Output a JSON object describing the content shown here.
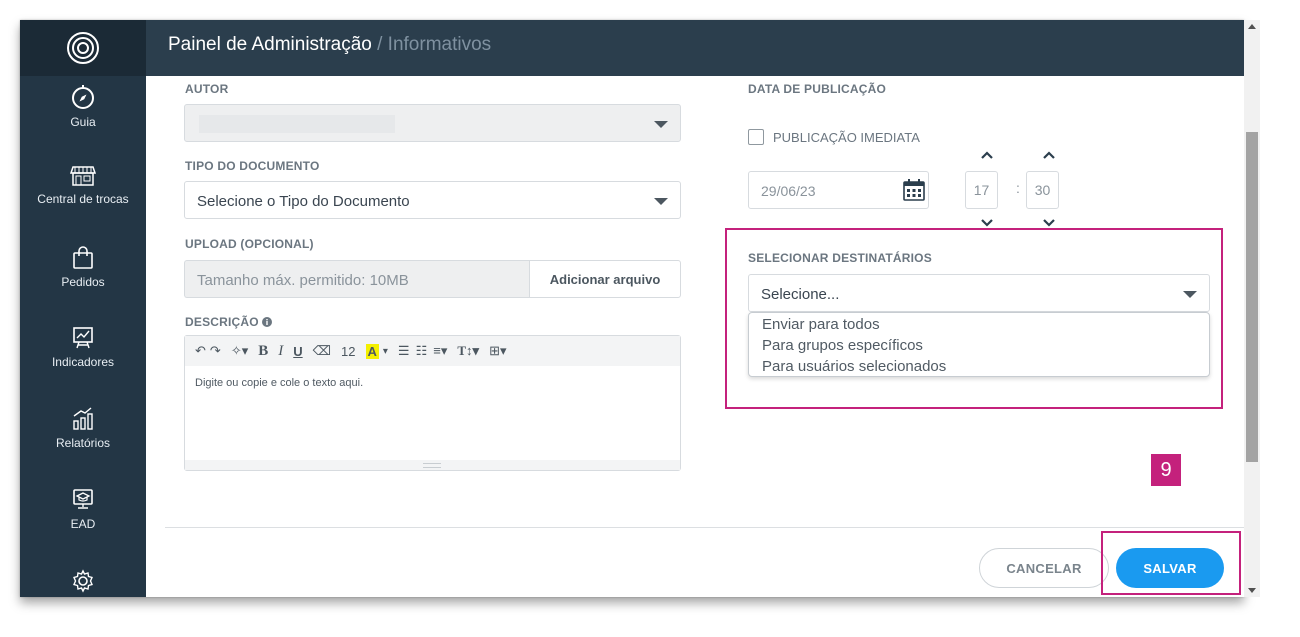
{
  "header": {
    "title": "Painel de Administração",
    "subtitle": "/ Informativos"
  },
  "sidebar": {
    "items": [
      {
        "label": "Guia",
        "icon": "compass-icon"
      },
      {
        "label": "Central de trocas",
        "icon": "store-icon"
      },
      {
        "label": "Pedidos",
        "icon": "shopping-bag-icon"
      },
      {
        "label": "Indicadores",
        "icon": "presentation-chart-icon"
      },
      {
        "label": "Relatórios",
        "icon": "bar-report-icon"
      },
      {
        "label": "EAD",
        "icon": "graduation-monitor-icon"
      }
    ]
  },
  "form": {
    "author_label": "AUTOR",
    "doc_type_label": "TIPO DO DOCUMENTO",
    "doc_type_value": "Selecione o Tipo do Documento",
    "upload_label": "UPLOAD (OPCIONAL)",
    "upload_placeholder": "Tamanho máx. permitido: 10MB",
    "upload_button": "Adicionar arquivo",
    "description_label": "DESCRIÇÃO",
    "editor_font_size": "12",
    "editor_placeholder": "Digite ou copie e cole o texto aqui.",
    "publish_date_label": "DATA DE PUBLICAÇÃO",
    "immediate_label": "PUBLICAÇÃO IMEDIATA",
    "date_value": "29/06/23",
    "hour_value": "17",
    "minute_value": "30",
    "time_separator": ":",
    "recipients_label": "SELECIONAR DESTINATÁRIOS",
    "recipients_value": "Selecione...",
    "recipients_options": [
      "Enviar para todos",
      "Para grupos específicos",
      "Para usuários selecionados"
    ]
  },
  "step_number": "9",
  "actions": {
    "cancel": "CANCELAR",
    "save": "SALVAR"
  },
  "colors": {
    "highlight": "#c4217c",
    "primary": "#1a9af0",
    "sidebar": "#233645"
  }
}
